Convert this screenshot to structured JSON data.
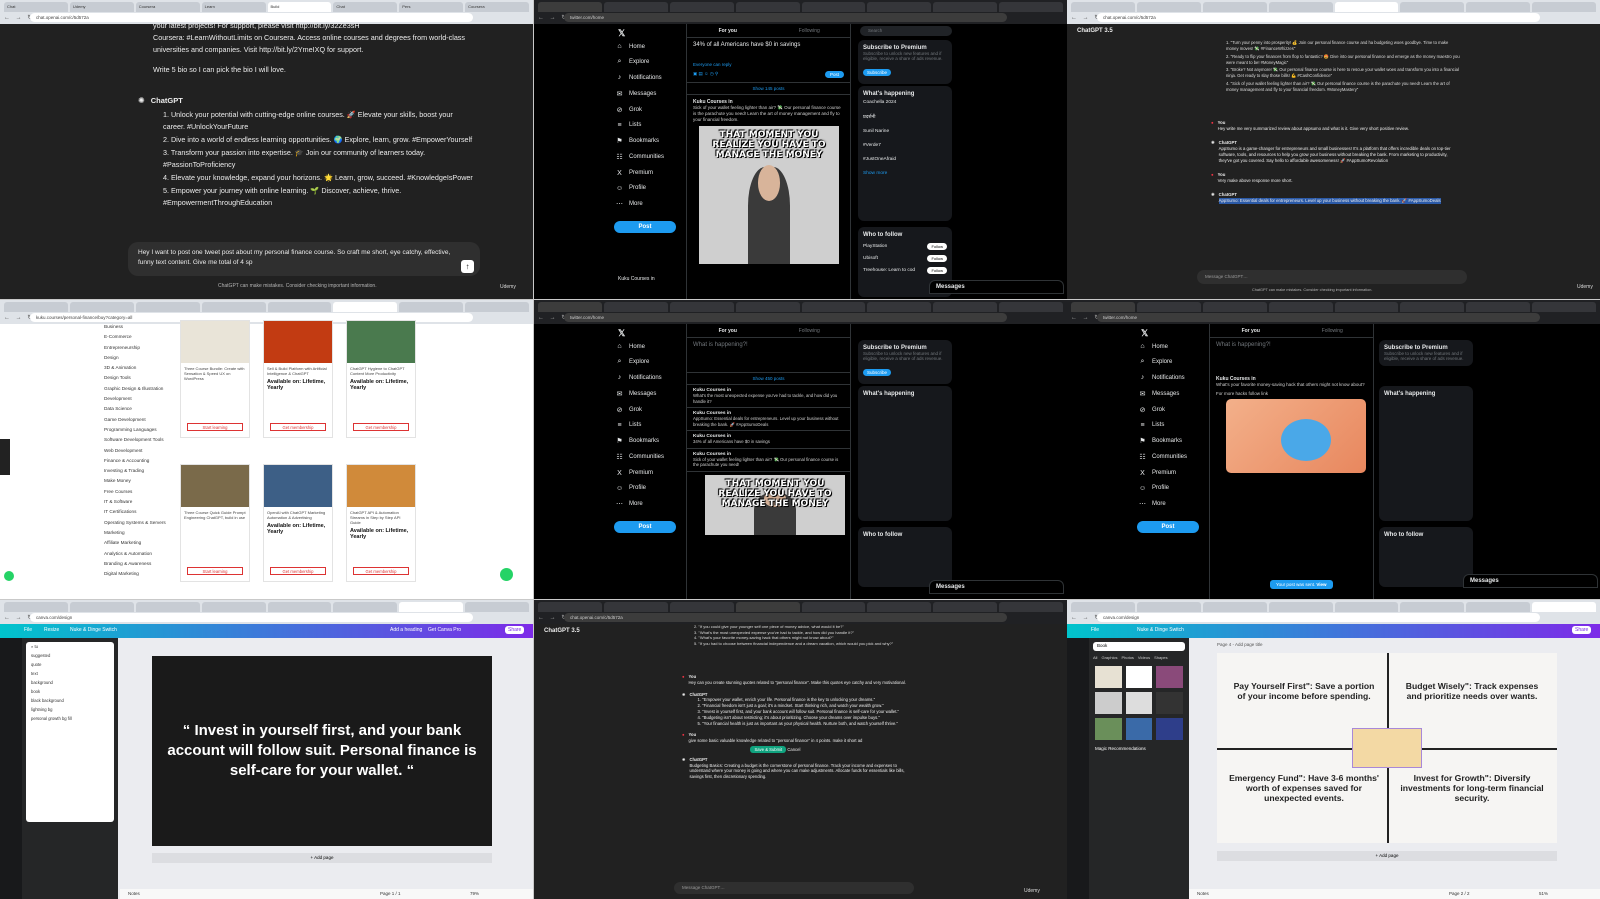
{
  "panel1": {
    "tabs": [
      "Chat",
      "Udemy",
      "Coursera",
      "Learn",
      "Build",
      "Chat",
      "Pers",
      "Coursera"
    ],
    "url": "chat.openai.com/c/5d572a",
    "prev_text_1": "your latest projects! For support, please visit http://bit.ly/32Ze3sH",
    "prev_text_2": "Coursera: #LearnWithoutLimits on Coursera. Access online courses and degrees from world-class universities and companies. Visit http://bit.ly/2YmeIXQ for support.",
    "prev_text_3": "Write 5 bio so I can pick the bio I will love.",
    "assistant_label": "ChatGPT",
    "bios": [
      "Unlock your potential with cutting-edge online courses. 🚀 Elevate your skills, boost your career. #UnlockYourFuture",
      "Dive into a world of endless learning opportunities. 🌍 Explore, learn, grow. #EmpowerYourself",
      "Transform your passion into expertise. 🎓 Join our community of learners today. #PassionToProficiency",
      "Elevate your knowledge, expand your horizons. 🌟 Learn, grow, succeed. #KnowledgeIsPower",
      "Empower your journey with online learning. 🌱 Discover, achieve, thrive. #EmpowermentThroughEducation"
    ],
    "composer_text": "Hey I want to post one tweet post about my personal finance course. So craft me short, eye catchy, effective, funny text content. Give me total of 4 sp",
    "footer": "ChatGPT can make mistakes. Consider checking important information.",
    "watermark": "Udemy"
  },
  "panel2": {
    "url": "twitter.com/home",
    "nav": [
      {
        "icon": "⌂",
        "label": "Home"
      },
      {
        "icon": "⌕",
        "label": "Explore"
      },
      {
        "icon": "♪",
        "label": "Notifications"
      },
      {
        "icon": "✉",
        "label": "Messages"
      },
      {
        "icon": "⊘",
        "label": "Grok"
      },
      {
        "icon": "≡",
        "label": "Lists"
      },
      {
        "icon": "⚑",
        "label": "Bookmarks"
      },
      {
        "icon": "☷",
        "label": "Communities"
      },
      {
        "icon": "X",
        "label": "Premium"
      },
      {
        "icon": "☺",
        "label": "Profile"
      },
      {
        "icon": "⋯",
        "label": "More"
      }
    ],
    "post_label": "Post",
    "feed_tabs": [
      "For you",
      "Following"
    ],
    "compose_text": "34% of all Americans have $0 in savings",
    "reply_note": "Everyone can reply",
    "post_btn": "Post",
    "show_posts": "Show 145 posts",
    "author": "Kuku Courses in",
    "tweet_text": "Sick of your wallet feeling lighter than air? 💸 Our personal finance course is the parachute you need! Learn the art of money management and fly to your financial freedom.",
    "meme_caption": "THAT MOMENT YOU REALIZE YOU HAVE TO MANAGE THE MONEY",
    "search_placeholder": "Search",
    "premium_title": "Subscribe to Premium",
    "premium_text": "Subscribe to unlock new features and if eligible, receive a share of ads revenue.",
    "subscribe": "Subscribe",
    "happening_title": "What's happening",
    "trends": [
      "Coachella 2024",
      "प्रदर्शनी",
      "Sunil Narine",
      "#Verde7",
      "#JustOneAfraid",
      "Show more"
    ],
    "follow_title": "Who to follow",
    "follows": [
      "PlayStation",
      "Ubisoft",
      "Treehouse: Learn to cod"
    ],
    "follow_btn": "Follow",
    "messages": "Messages",
    "profile_name": "Kuku Courses in"
  },
  "panel3": {
    "title": "ChatGPT 3.5",
    "ideas": [
      "\"Turn your penny into prosperity! 💰 Join our personal finance course and ha budgeting woes goodbye. Time to make money moves! 💸 #FinanceWhizzes\"",
      "\"Ready to flip your finances from flop to fantastic? 🤩 Dive into our personal finance and emerge as the money maestro you were meant to be! #MoneyMagic\"",
      "\"Broke? Not anymore! 💸 Our personal finance course is here to rescue your wallet woes and transform you into a financial ninja. Get ready to slay those bills! 💪 #CashConfidence\"",
      "\"Sick of your wallet feeling lighter than air? 💸 Our personal finance course is the parachute you need! Learn the art of money management and fly to your financial freedom. #MoneyMastery\""
    ],
    "you_label": "You",
    "you_msg_1": "Hey write me very summarized review about appsumo and what is it. Give very short positive review.",
    "gpt_label": "ChatGPT",
    "gpt_msg_1": "AppSumo is a game-changer for entrepreneurs and small businesses! It's a platform that offers incredible deals on top-tier software, tools, and resources to help you grow your business without breaking the bank. From marketing to productivity, they've got you covered. Say hello to affordable awesomeness! 🚀 #AppSumoRevolution",
    "you_msg_2": "Very make above response more short.",
    "gpt_msg_2": "AppSumo: Essential deals for entrepreneurs. Level up your business without breaking the bank. 🚀 #AppSumoDeals",
    "composer": "Message ChatGPT…",
    "footer": "ChatGPT can make mistakes. Consider checking important information.",
    "watermark": "Udemy"
  },
  "panel4": {
    "url": "kuku.courses/personal-finance/buy?category=all",
    "categories": [
      "Business",
      "E-Commerce",
      "Entrepreneurship",
      "Design",
      "3D & Animation",
      "Design Tools",
      "Graphic Design & Illustration",
      "Development",
      "Data Science",
      "Game Development",
      "Programming Languages",
      "Software Development Tools",
      "Web Development",
      "Finance & Accounting",
      "Investing & Trading",
      "Make Money",
      "Free Courses",
      "IT & Software",
      "IT Certifications",
      "Operating Systems & Servers",
      "Marketing",
      "Affiliate Marketing",
      "Analytics & Automation",
      "Branding & Awareness",
      "Digital Marketing"
    ],
    "cards": [
      {
        "title": "Three Course Bundle: Create with Sensation & Speed UX on WordPress",
        "avail": "",
        "btn": "Start learning",
        "color": "#e9e4d8"
      },
      {
        "title": "Sell & Build Platform with Artificial Intelligence & ChatGPT",
        "avail": "Available on: Lifetime, Yearly",
        "btn": "Get membership",
        "color": "#c23b12"
      },
      {
        "title": "ChatGPT Hygiene to ChatGPT Content More Productivity",
        "avail": "Available on: Lifetime, Yearly",
        "btn": "Get membership",
        "color": "#4a7a4e"
      },
      {
        "title": "Three Course Quick Guide Prompt Engineering ChatGPT, build in use",
        "avail": "",
        "btn": "Start learning",
        "color": "#7a6a4a"
      },
      {
        "title": "OpenAI with ChatGPT Marketing Automation & Advertising",
        "avail": "Available on: Lifetime, Yearly",
        "btn": "Get membership",
        "color": "#3d5f86"
      },
      {
        "title": "ChatGPT API & Automation Streams in Step by Step API Guide",
        "avail": "Available on: Lifetime, Yearly",
        "btn": "Get membership",
        "color": "#d08a3a"
      }
    ]
  },
  "panel5": {
    "compose_placeholder": "What is happening?!",
    "show_posts": "Show 450 posts",
    "tweets": [
      "What's the most unexpected expense you've had to tackle, and how did you handle it?",
      "AppSumo: Essential deals for entrepreneurs. Level up your business without breaking the bank. 🚀 #AppSumoDeals",
      "34% of all Americans have $0 in savings",
      "Sick of your wallet feeling lighter than air? 💸 Our personal finance course is the parachute you need!"
    ],
    "meme_caption": "THAT MOMENT YOU REALIZE YOU HAVE TO MANAGE THE MONEY"
  },
  "panel6": {
    "tweet_q": "What's your favorite money-saving hack that others might not know about?",
    "more": "For more hacks follow link",
    "toast": "Your post was sent.",
    "toast_view": "View"
  },
  "panel7": {
    "app_name": "Nuke & Dinge Switch",
    "menu_file": "File",
    "resize": "Resize",
    "share": "Share",
    "add_heading": "Add a heading",
    "pro_btn": "Get Canva Pro",
    "quote": "“ Invest in yourself first, and your bank account will follow suit. Personal finance is self-care for your wallet. “",
    "add_page": "+ Add page",
    "notes": "Notes",
    "page": "Page 1 / 1",
    "zoom": "79%",
    "search_items": [
      "tu",
      "suggested",
      "quote",
      "text",
      "background",
      "book",
      "black background",
      "lightning bg",
      "personal growth bg fill"
    ]
  },
  "panel8": {
    "title": "ChatGPT 3.5",
    "pre_lines": [
      "\"If you could give your younger self one piece of money advice, what would it be?\"",
      "\"What's the most unexpected expense you've had to tackle, and how did you handle it?\"",
      "\"What's your favorite money-saving hack that others might not know about?\"",
      "\"If you had to choose between financial independence and a dream vacation, which would you pick and why?\""
    ],
    "you_msg": "Hey can you create stunning quotes related to \"personal finance\". Make this quotes eye catchy and very motivational.",
    "quotes": [
      "\"Empower your wallet, enrich your life. Personal finance is the key to unlocking your dreams.\"",
      "\"Financial freedom isn't just a goal; it's a mindset. Start thinking rich, and watch your wealth grow.\"",
      "\"Invest in yourself first, and your bank account will follow suit. Personal finance is self-care for your wallet.\"",
      "\"Budgeting isn't about restricting; it's about prioritizing. Choose your dreams over impulse buys.\"",
      "\"Your financial health is just as important as your physical health. Nurture both, and watch yourself thrive.\""
    ],
    "you_msg_2": "give some basic valuable knowledge related to \"personal finance\" in 4 points. make it short ad",
    "save_btn": "Save & Submit",
    "cancel_btn": "Cancel",
    "gpt_label": "ChatGPT",
    "answer": "Budgeting Basics: Creating a budget is the cornerstone of personal finance. Track your income and expenses to understand where your money is going and where you can make adjustments. Allocate funds for essentials like bills, savings first, then discretionary spending.",
    "composer": "Message ChatGPT…",
    "watermark": "Udemy"
  },
  "panel9": {
    "search": "Book",
    "tabs": [
      "All",
      "Graphics",
      "Photos",
      "Videos",
      "Shapes"
    ],
    "magic": "Magic Recommendations",
    "page_title": "Page 4 - Add page title",
    "tips": [
      "Pay Yourself First\": Save a portion of your income before spending.",
      "Budget Wisely\": Track expenses and prioritize needs over wants.",
      "Emergency Fund\": Have 3-6 months' worth of expenses saved for unexpected events.",
      "Invest for Growth\": Diversify investments for long-term financial security."
    ],
    "add_page": "+ Add page",
    "notes": "Notes",
    "page": "Page 2 / 2",
    "zoom": "51%"
  }
}
